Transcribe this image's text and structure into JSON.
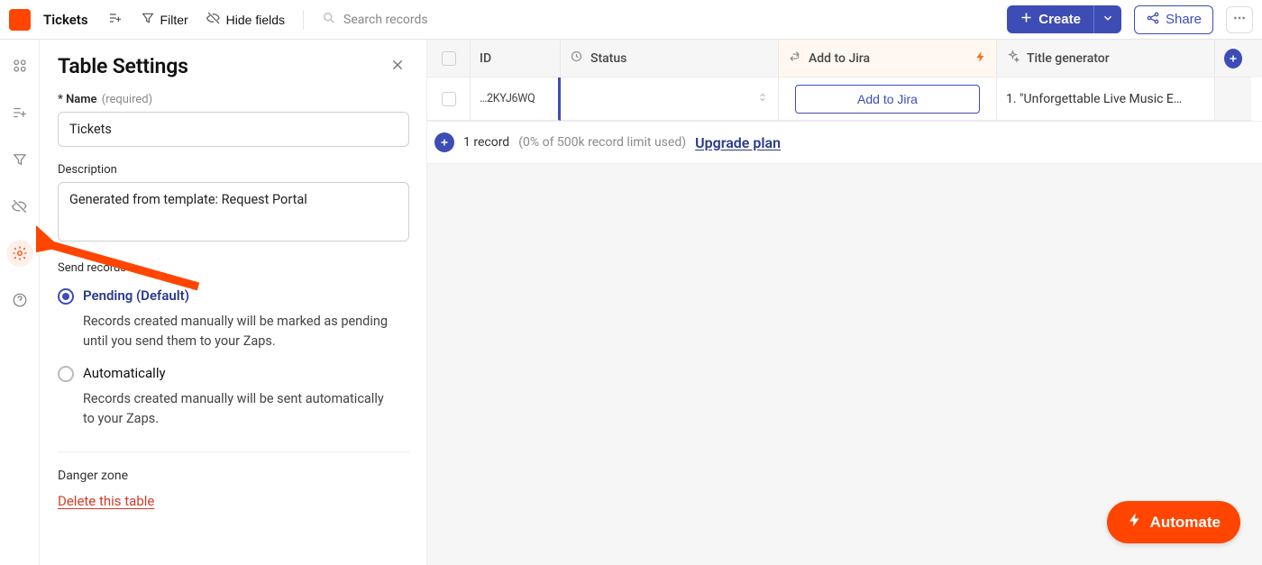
{
  "header": {
    "table_name": "Tickets",
    "filter_label": "Filter",
    "hide_fields_label": "Hide fields",
    "search_placeholder": "Search records",
    "create_label": "Create",
    "share_label": "Share"
  },
  "settings": {
    "title": "Table Settings",
    "name_field": {
      "prefix": "* Name",
      "hint": "(required)",
      "value": "Tickets"
    },
    "description_field": {
      "label": "Description",
      "value": "Generated from template: Request Portal"
    },
    "send_records": {
      "label": "Send records",
      "options": [
        {
          "key": "pending",
          "label": "Pending (Default)",
          "desc": "Records created manually will be marked as pending until you send them to your Zaps.",
          "selected": true
        },
        {
          "key": "auto",
          "label": "Automatically",
          "desc": "Records created manually will be sent automatically to your Zaps.",
          "selected": false
        }
      ]
    },
    "danger": {
      "label": "Danger zone",
      "delete_label": "Delete this table"
    }
  },
  "grid": {
    "columns": {
      "id": "ID",
      "status": "Status",
      "jira": "Add to Jira",
      "title_gen": "Title generator"
    },
    "rows": [
      {
        "id": "…2KYJ6WQ",
        "status": "",
        "jira_button": "Add to Jira",
        "title_gen": "1. \"Unforgettable Live Music E…"
      }
    ],
    "footer": {
      "count_text": "1 record",
      "limit_text": "(0% of 500k record limit used)",
      "upgrade": "Upgrade plan"
    }
  },
  "automate_label": "Automate"
}
